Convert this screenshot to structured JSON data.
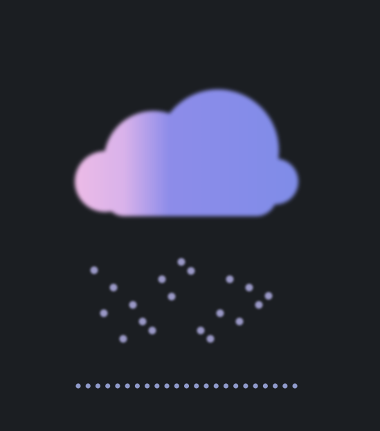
{
  "icon": "snow-cloud-icon",
  "colors": {
    "background": "#1b1e22",
    "cloud_left": "#ecbbe6",
    "cloud_right": "#7f8ce8",
    "snow": "#9a98c6",
    "ground": "#8f9acb"
  }
}
